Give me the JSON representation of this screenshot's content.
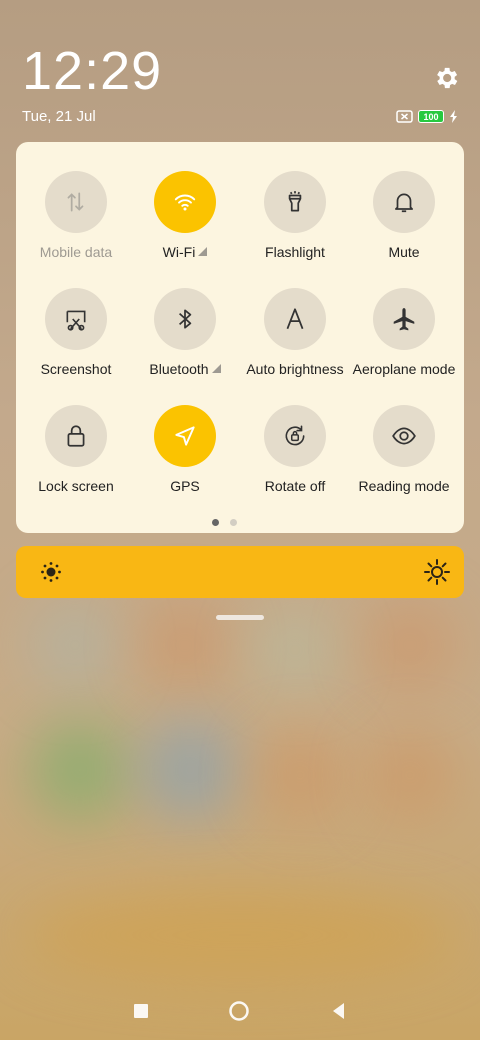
{
  "status": {
    "time": "12:29",
    "date": "Tue, 21 Jul",
    "battery_level": "100"
  },
  "tiles": [
    {
      "label": "Mobile data",
      "icon": "mobile-data-icon",
      "active": false,
      "dim": true
    },
    {
      "label": "Wi-Fi",
      "icon": "wifi-icon",
      "active": true,
      "has_signal": true
    },
    {
      "label": "Flashlight",
      "icon": "flashlight-icon",
      "active": false
    },
    {
      "label": "Mute",
      "icon": "bell-icon",
      "active": false
    },
    {
      "label": "Screenshot",
      "icon": "screenshot-icon",
      "active": false
    },
    {
      "label": "Bluetooth",
      "icon": "bluetooth-icon",
      "active": false,
      "has_signal": true
    },
    {
      "label": "Auto brightness",
      "icon": "auto-brightness-icon",
      "active": false
    },
    {
      "label": "Aeroplane mode",
      "icon": "airplane-icon",
      "active": false
    },
    {
      "label": "Lock screen",
      "icon": "lock-icon",
      "active": false
    },
    {
      "label": "GPS",
      "icon": "gps-arrow-icon",
      "active": true
    },
    {
      "label": "Rotate off",
      "icon": "rotate-lock-icon",
      "active": false
    },
    {
      "label": "Reading mode",
      "icon": "eye-icon",
      "active": false
    }
  ],
  "pager": {
    "pages": 2,
    "current": 1
  },
  "brightness": {
    "level": 1.0
  },
  "colors": {
    "accent": "#fbc300",
    "panel": "#fcf5e0",
    "slider": "#f9b714"
  }
}
